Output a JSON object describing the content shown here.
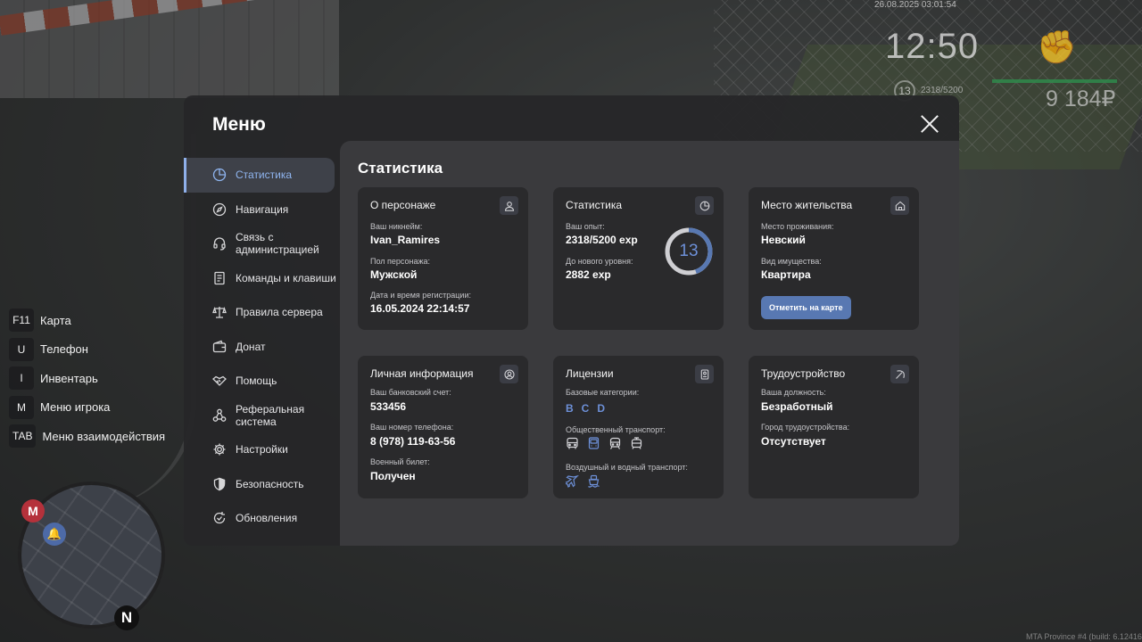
{
  "hud": {
    "datetime": "26.08.2025 03:01:54",
    "clock": "12:50",
    "level": "13",
    "exp": "2318/5200",
    "money": "9 184₽",
    "build": "MTA Province #4 (build: 6.12416.9)",
    "health_color": "#2f8a4b"
  },
  "keybinds": [
    {
      "key": "F11",
      "label": "Карта"
    },
    {
      "key": "U",
      "label": "Телефон"
    },
    {
      "key": "I",
      "label": "Инвентарь"
    },
    {
      "key": "M",
      "label": "Меню игрока"
    },
    {
      "key": "TAB",
      "label": "Меню взаимодействия"
    }
  ],
  "minimap": {
    "metro_label": "М",
    "north_label": "N",
    "blip_icon": "bell-icon"
  },
  "menu": {
    "title": "Меню",
    "accent_color": "#8fb5f0",
    "nav": [
      {
        "label": "Статистика",
        "icon": "pie-chart-icon",
        "active": true
      },
      {
        "label": "Навигация",
        "icon": "compass-icon"
      },
      {
        "label": "Связь с администрацией",
        "icon": "headset-icon"
      },
      {
        "label": "Команды и клавиши",
        "icon": "document-icon"
      },
      {
        "label": "Правила сервера",
        "icon": "scales-icon"
      },
      {
        "label": "Донат",
        "icon": "wallet-icon"
      },
      {
        "label": "Помощь",
        "icon": "handshake-icon"
      },
      {
        "label": "Реферальная система",
        "icon": "referral-icon"
      },
      {
        "label": "Настройки",
        "icon": "gear-icon"
      },
      {
        "label": "Безопасность",
        "icon": "shield-icon"
      },
      {
        "label": "Обновления",
        "icon": "refresh-icon"
      }
    ]
  },
  "stats": {
    "title": "Статистика",
    "character": {
      "title": "О персонаже",
      "icon": "user-icon",
      "nickname_label": "Ваш никнейм:",
      "nickname": "Ivan_Ramires",
      "gender_label": "Пол персонажа:",
      "gender": "Мужской",
      "reg_label": "Дата и время регистрации:",
      "reg_date": "16.05.2024 22:14:57"
    },
    "statistics": {
      "title": "Статистика",
      "icon": "pie-chart-icon",
      "exp_label": "Ваш опыт:",
      "exp": "2318/5200 exp",
      "next_label": "До нового уровня:",
      "next": "2882 exp",
      "level": "13",
      "level_progress": 0.4458
    },
    "residence": {
      "title": "Место жительства",
      "icon": "home-icon",
      "place_label": "Место проживания:",
      "place": "Невский",
      "property_label": "Вид имущества:",
      "property": "Квартира",
      "button": "Отметить на карте"
    },
    "personal": {
      "title": "Личная информация",
      "icon": "user-circle-icon",
      "bank_label": "Ваш банковский счет:",
      "bank": "533456",
      "phone_label": "Ваш номер телефона:",
      "phone": "8 (978) 119-63-56",
      "military_label": "Военный билет:",
      "military": "Получен"
    },
    "licenses": {
      "title": "Лицензии",
      "icon": "id-card-icon",
      "base_label": "Базовые категории:",
      "categories": [
        "B",
        "C",
        "D"
      ],
      "public_label": "Общественный транспорт:",
      "public_icons": [
        "bus-icon",
        "bus-front-icon",
        "train-icon",
        "tram-icon"
      ],
      "air_label": "Воздушный и водный транспорт:",
      "air_icons": [
        "plane-icon",
        "ship-icon"
      ]
    },
    "employment": {
      "title": "Трудоустройство",
      "icon": "pickaxe-icon",
      "position_label": "Ваша должность:",
      "position": "Безработный",
      "city_label": "Город трудоустройства:",
      "city": "Отсутствует"
    }
  }
}
